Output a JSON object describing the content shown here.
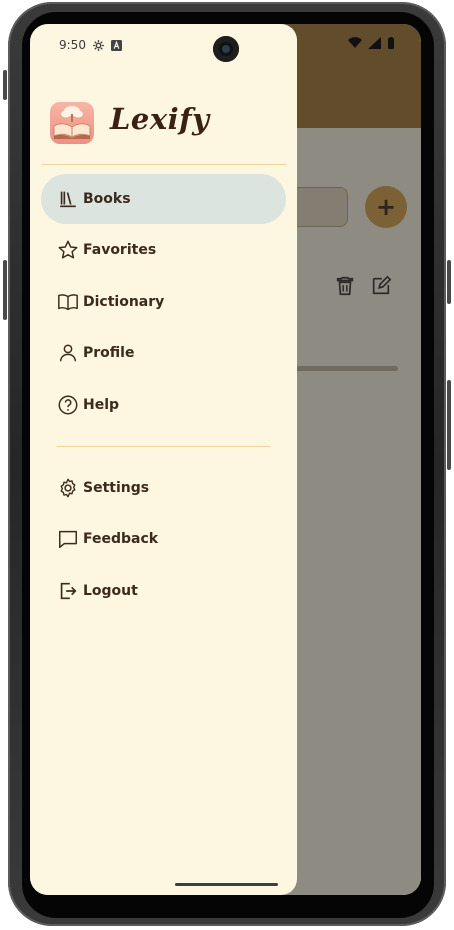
{
  "status_bar": {
    "time": "9:50"
  },
  "drawer": {
    "brand": "Lexify",
    "nav_primary": [
      {
        "label": "Books",
        "icon": "books-icon",
        "active": true
      },
      {
        "label": "Favorites",
        "icon": "star-icon",
        "active": false
      },
      {
        "label": "Dictionary",
        "icon": "open-book-icon",
        "active": false
      },
      {
        "label": "Profile",
        "icon": "person-icon",
        "active": false
      },
      {
        "label": "Help",
        "icon": "help-circle-icon",
        "active": false
      }
    ],
    "nav_secondary": [
      {
        "label": "Settings",
        "icon": "gear-icon"
      },
      {
        "label": "Feedback",
        "icon": "chat-bubble-icon"
      },
      {
        "label": "Logout",
        "icon": "logout-icon"
      }
    ]
  },
  "background_app": {
    "fab_label": "+"
  },
  "colors": {
    "drawer_bg": "#fdf6e1",
    "app_bar": "#a0742e",
    "active_item_bg": "#dce4df",
    "text": "#3c2a1c",
    "accent_fab": "#d69f43"
  }
}
